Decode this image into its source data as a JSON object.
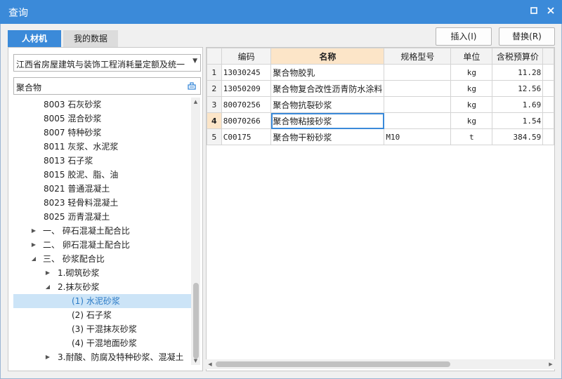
{
  "window": {
    "title": "查询"
  },
  "tabs": [
    {
      "label": "人材机",
      "active": true
    },
    {
      "label": "我的数据",
      "active": false
    }
  ],
  "toolbar": {
    "insert_label": "插入(I)",
    "replace_label": "替换(R)"
  },
  "combo": {
    "value": "江西省房屋建筑与装饰工程消耗量定额及统一基价表"
  },
  "search": {
    "value": "聚合物"
  },
  "tree": [
    {
      "label": "8003 石灰砂浆",
      "level": 3,
      "expander": ""
    },
    {
      "label": "8005 混合砂浆",
      "level": 3,
      "expander": ""
    },
    {
      "label": "8007 特种砂浆",
      "level": 3,
      "expander": ""
    },
    {
      "label": "8011 灰浆、水泥浆",
      "level": 3,
      "expander": ""
    },
    {
      "label": "8013 石子浆",
      "level": 3,
      "expander": ""
    },
    {
      "label": "8015 胶泥、脂、油",
      "level": 3,
      "expander": ""
    },
    {
      "label": "8021 普通混凝土",
      "level": 3,
      "expander": ""
    },
    {
      "label": "8023 轻骨料混凝土",
      "level": 3,
      "expander": ""
    },
    {
      "label": "8025 沥青混凝土",
      "level": 3,
      "expander": ""
    },
    {
      "label": "一、 碎石混凝土配合比",
      "level": 1,
      "expander": "collapsed"
    },
    {
      "label": "二、 卵石混凝土配合比",
      "level": 1,
      "expander": "collapsed"
    },
    {
      "label": "三、 砂浆配合比",
      "level": 1,
      "expander": "expanded"
    },
    {
      "label": "1.砌筑砂浆",
      "level": 2,
      "expander": "collapsed"
    },
    {
      "label": "2.抹灰砂浆",
      "level": 2,
      "expander": "expanded"
    },
    {
      "label": "(1) 水泥砂浆",
      "level": 4,
      "expander": "",
      "selected": true
    },
    {
      "label": "(2) 石子浆",
      "level": 4,
      "expander": ""
    },
    {
      "label": "(3) 干混抹灰砂浆",
      "level": 4,
      "expander": ""
    },
    {
      "label": "(4) 干混地面砂浆",
      "level": 4,
      "expander": ""
    },
    {
      "label": "3.耐酸、防腐及特种砂浆、混凝土",
      "level": 2,
      "expander": "collapsed"
    }
  ],
  "grid": {
    "columns": [
      "编码",
      "名称",
      "规格型号",
      "单位",
      "含税预算价"
    ],
    "highlight_column": 1,
    "current_row": 3,
    "rows": [
      {
        "no": "1",
        "code": "13030245",
        "name": "聚合物胶乳",
        "spec": "",
        "unit": "kg",
        "price": "11.28"
      },
      {
        "no": "2",
        "code": "13050209",
        "name": "聚合物复合改性沥青防水涂料",
        "spec": "",
        "unit": "kg",
        "price": "12.56"
      },
      {
        "no": "3",
        "code": "80070256",
        "name": "聚合物抗裂砂浆",
        "spec": "",
        "unit": "kg",
        "price": "1.69"
      },
      {
        "no": "4",
        "code": "80070266",
        "name": "聚合物粘接砂浆",
        "spec": "",
        "unit": "kg",
        "price": "1.54"
      },
      {
        "no": "5",
        "code": "C00175",
        "name": "聚合物干粉砂浆",
        "spec": "M10",
        "unit": "t",
        "price": "384.59"
      }
    ]
  },
  "colors": {
    "accent": "#3b8ad9",
    "selected_row_bg": "#cce4f7",
    "header_highlight": "#fce5c8"
  }
}
